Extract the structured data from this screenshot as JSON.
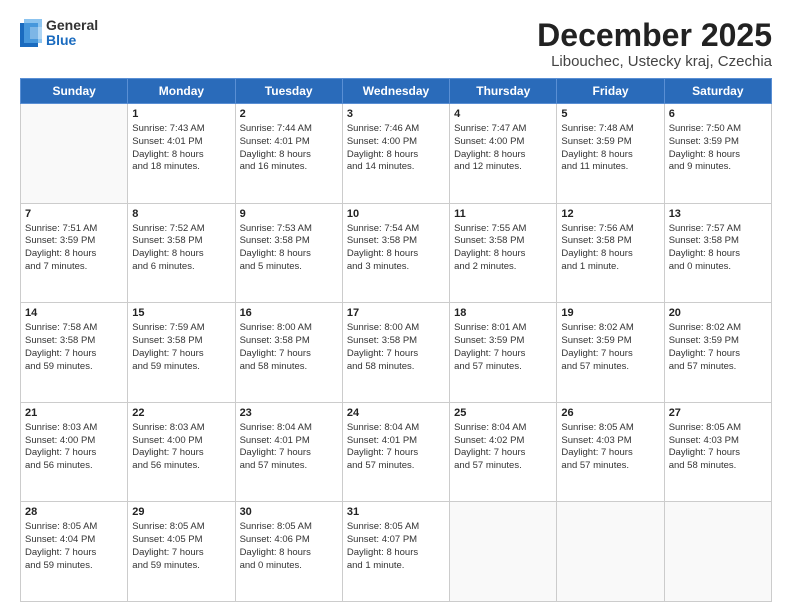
{
  "logo": {
    "general": "General",
    "blue": "Blue"
  },
  "header": {
    "title": "December 2025",
    "subtitle": "Libouchec, Ustecky kraj, Czechia"
  },
  "weekdays": [
    "Sunday",
    "Monday",
    "Tuesday",
    "Wednesday",
    "Thursday",
    "Friday",
    "Saturday"
  ],
  "weeks": [
    [
      {
        "day": "",
        "info": ""
      },
      {
        "day": "1",
        "info": "Sunrise: 7:43 AM\nSunset: 4:01 PM\nDaylight: 8 hours\nand 18 minutes."
      },
      {
        "day": "2",
        "info": "Sunrise: 7:44 AM\nSunset: 4:01 PM\nDaylight: 8 hours\nand 16 minutes."
      },
      {
        "day": "3",
        "info": "Sunrise: 7:46 AM\nSunset: 4:00 PM\nDaylight: 8 hours\nand 14 minutes."
      },
      {
        "day": "4",
        "info": "Sunrise: 7:47 AM\nSunset: 4:00 PM\nDaylight: 8 hours\nand 12 minutes."
      },
      {
        "day": "5",
        "info": "Sunrise: 7:48 AM\nSunset: 3:59 PM\nDaylight: 8 hours\nand 11 minutes."
      },
      {
        "day": "6",
        "info": "Sunrise: 7:50 AM\nSunset: 3:59 PM\nDaylight: 8 hours\nand 9 minutes."
      }
    ],
    [
      {
        "day": "7",
        "info": "Sunrise: 7:51 AM\nSunset: 3:59 PM\nDaylight: 8 hours\nand 7 minutes."
      },
      {
        "day": "8",
        "info": "Sunrise: 7:52 AM\nSunset: 3:58 PM\nDaylight: 8 hours\nand 6 minutes."
      },
      {
        "day": "9",
        "info": "Sunrise: 7:53 AM\nSunset: 3:58 PM\nDaylight: 8 hours\nand 5 minutes."
      },
      {
        "day": "10",
        "info": "Sunrise: 7:54 AM\nSunset: 3:58 PM\nDaylight: 8 hours\nand 3 minutes."
      },
      {
        "day": "11",
        "info": "Sunrise: 7:55 AM\nSunset: 3:58 PM\nDaylight: 8 hours\nand 2 minutes."
      },
      {
        "day": "12",
        "info": "Sunrise: 7:56 AM\nSunset: 3:58 PM\nDaylight: 8 hours\nand 1 minute."
      },
      {
        "day": "13",
        "info": "Sunrise: 7:57 AM\nSunset: 3:58 PM\nDaylight: 8 hours\nand 0 minutes."
      }
    ],
    [
      {
        "day": "14",
        "info": "Sunrise: 7:58 AM\nSunset: 3:58 PM\nDaylight: 7 hours\nand 59 minutes."
      },
      {
        "day": "15",
        "info": "Sunrise: 7:59 AM\nSunset: 3:58 PM\nDaylight: 7 hours\nand 59 minutes."
      },
      {
        "day": "16",
        "info": "Sunrise: 8:00 AM\nSunset: 3:58 PM\nDaylight: 7 hours\nand 58 minutes."
      },
      {
        "day": "17",
        "info": "Sunrise: 8:00 AM\nSunset: 3:58 PM\nDaylight: 7 hours\nand 58 minutes."
      },
      {
        "day": "18",
        "info": "Sunrise: 8:01 AM\nSunset: 3:59 PM\nDaylight: 7 hours\nand 57 minutes."
      },
      {
        "day": "19",
        "info": "Sunrise: 8:02 AM\nSunset: 3:59 PM\nDaylight: 7 hours\nand 57 minutes."
      },
      {
        "day": "20",
        "info": "Sunrise: 8:02 AM\nSunset: 3:59 PM\nDaylight: 7 hours\nand 57 minutes."
      }
    ],
    [
      {
        "day": "21",
        "info": "Sunrise: 8:03 AM\nSunset: 4:00 PM\nDaylight: 7 hours\nand 56 minutes."
      },
      {
        "day": "22",
        "info": "Sunrise: 8:03 AM\nSunset: 4:00 PM\nDaylight: 7 hours\nand 56 minutes."
      },
      {
        "day": "23",
        "info": "Sunrise: 8:04 AM\nSunset: 4:01 PM\nDaylight: 7 hours\nand 57 minutes."
      },
      {
        "day": "24",
        "info": "Sunrise: 8:04 AM\nSunset: 4:01 PM\nDaylight: 7 hours\nand 57 minutes."
      },
      {
        "day": "25",
        "info": "Sunrise: 8:04 AM\nSunset: 4:02 PM\nDaylight: 7 hours\nand 57 minutes."
      },
      {
        "day": "26",
        "info": "Sunrise: 8:05 AM\nSunset: 4:03 PM\nDaylight: 7 hours\nand 57 minutes."
      },
      {
        "day": "27",
        "info": "Sunrise: 8:05 AM\nSunset: 4:03 PM\nDaylight: 7 hours\nand 58 minutes."
      }
    ],
    [
      {
        "day": "28",
        "info": "Sunrise: 8:05 AM\nSunset: 4:04 PM\nDaylight: 7 hours\nand 59 minutes."
      },
      {
        "day": "29",
        "info": "Sunrise: 8:05 AM\nSunset: 4:05 PM\nDaylight: 7 hours\nand 59 minutes."
      },
      {
        "day": "30",
        "info": "Sunrise: 8:05 AM\nSunset: 4:06 PM\nDaylight: 8 hours\nand 0 minutes."
      },
      {
        "day": "31",
        "info": "Sunrise: 8:05 AM\nSunset: 4:07 PM\nDaylight: 8 hours\nand 1 minute."
      },
      {
        "day": "",
        "info": ""
      },
      {
        "day": "",
        "info": ""
      },
      {
        "day": "",
        "info": ""
      }
    ]
  ]
}
